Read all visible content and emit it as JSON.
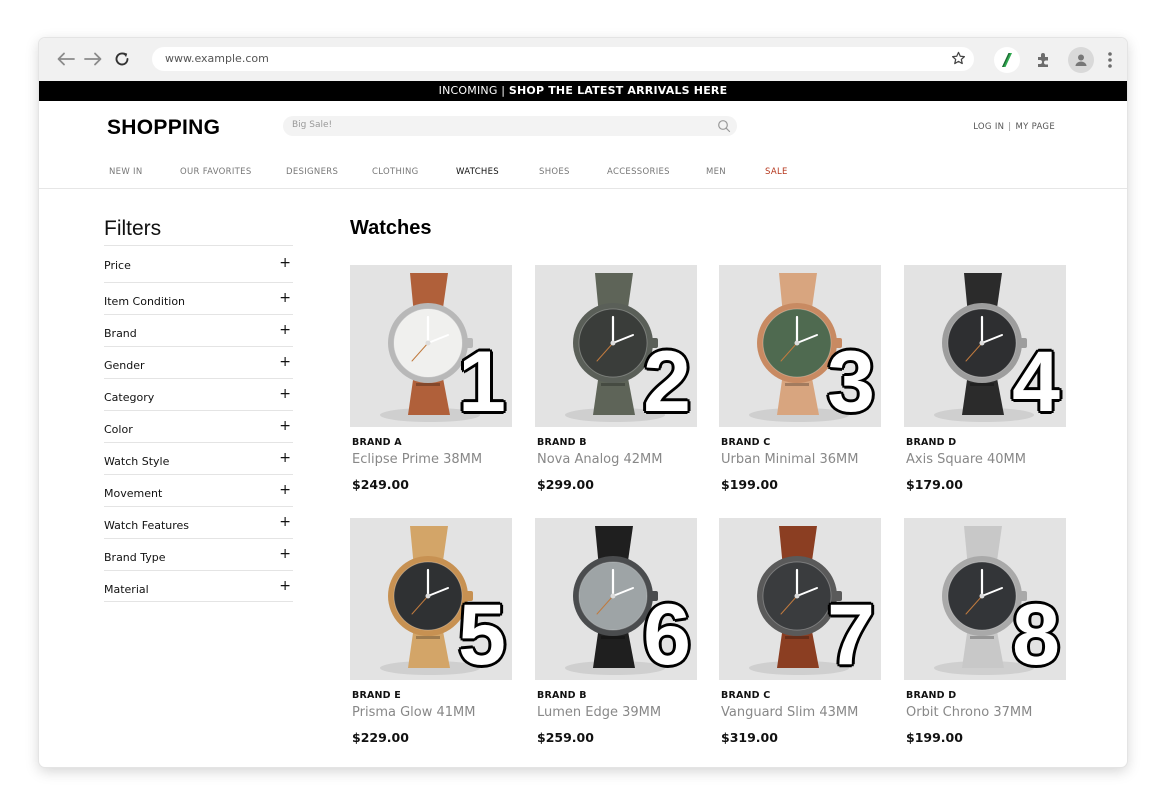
{
  "browser": {
    "url": "www.example.com"
  },
  "banner": {
    "prefix": "INCOMING | ",
    "highlight": "SHOP THE LATEST ARRIVALS HERE"
  },
  "header": {
    "logo": "SHOPPING",
    "search_placeholder": "Big Sale!",
    "login": "LOG IN",
    "separator": "|",
    "mypage": "MY PAGE"
  },
  "categories": [
    {
      "label": "NEW IN"
    },
    {
      "label": "OUR FAVORITES"
    },
    {
      "label": "DESIGNERS"
    },
    {
      "label": "CLOTHING"
    },
    {
      "label": "WATCHES"
    },
    {
      "label": "SHOES"
    },
    {
      "label": "ACCESSORIES"
    },
    {
      "label": "MEN"
    },
    {
      "label": "SALE"
    }
  ],
  "filters": {
    "title": "Filters",
    "items": [
      {
        "label": "Price"
      },
      {
        "label": "Item Condition"
      },
      {
        "label": "Brand"
      },
      {
        "label": "Gender"
      },
      {
        "label": "Category"
      },
      {
        "label": "Color"
      },
      {
        "label": "Watch Style"
      },
      {
        "label": "Movement"
      },
      {
        "label": "Watch Features"
      },
      {
        "label": "Brand Type"
      },
      {
        "label": "Material"
      }
    ]
  },
  "section": {
    "title": "Watches"
  },
  "products": [
    {
      "num": "1",
      "brand": "BRAND A",
      "name": "Eclipse Prime 38MM",
      "price": "$249.00",
      "dial": "#f0f0ee",
      "strap": "#b0603a",
      "case": "#b8b8b8"
    },
    {
      "num": "2",
      "brand": "BRAND B",
      "name": "Nova Analog 42MM",
      "price": "$299.00",
      "dial": "#3a3d3a",
      "strap": "#5e6458",
      "case": "#5a5f58"
    },
    {
      "num": "3",
      "brand": "BRAND C",
      "name": "Urban Minimal 36MM",
      "price": "$199.00",
      "dial": "#4f6a50",
      "strap": "#d8a57f",
      "case": "#c88a62"
    },
    {
      "num": "4",
      "brand": "BRAND D",
      "name": "Axis Square 40MM",
      "price": "$179.00",
      "dial": "#2e2f31",
      "strap": "#2b2b2b",
      "case": "#9d9d9d"
    },
    {
      "num": "5",
      "brand": "BRAND E",
      "name": "Prisma Glow 41MM",
      "price": "$229.00",
      "dial": "#2f3133",
      "strap": "#d3a568",
      "case": "#c79152"
    },
    {
      "num": "6",
      "brand": "BRAND B",
      "name": "Lumen Edge 39MM",
      "price": "$259.00",
      "dial": "#9ea4a6",
      "strap": "#1f1f1f",
      "case": "#4a4c4e"
    },
    {
      "num": "7",
      "brand": "BRAND C",
      "name": "Vanguard Slim 43MM",
      "price": "$319.00",
      "dial": "#3a3c3e",
      "strap": "#8b3e22",
      "case": "#5a5a5a"
    },
    {
      "num": "8",
      "brand": "BRAND D",
      "name": "Orbit Chrono 37MM",
      "price": "$199.00",
      "dial": "#333538",
      "strap": "#c8c8c8",
      "case": "#a9a9a9"
    }
  ]
}
